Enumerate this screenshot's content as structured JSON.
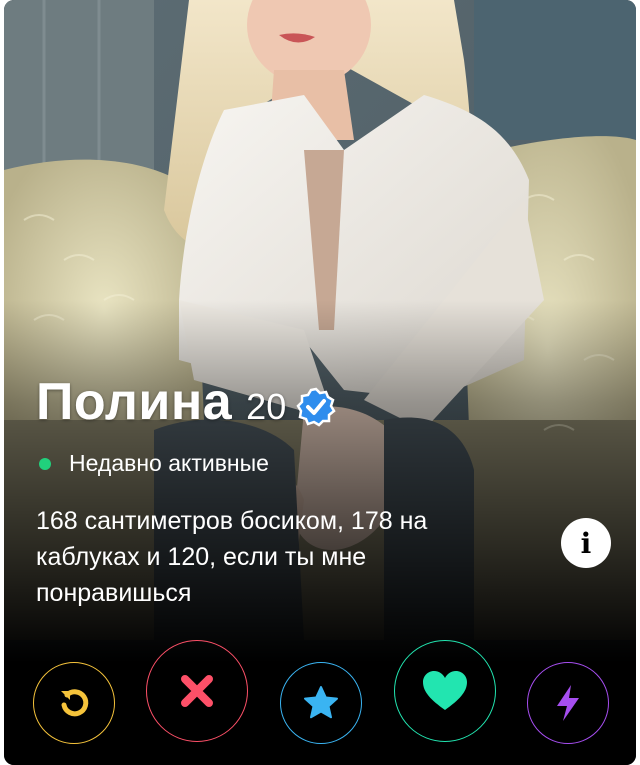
{
  "profile": {
    "name": "Полина",
    "age": "20",
    "verified_icon": "verified-check-icon",
    "status_text": "Недавно активные",
    "bio_lines": [
      "168 сантиметров босиком, 178 на",
      "каблуках и 120, если ты мне",
      "понравишься"
    ]
  },
  "info_button": {
    "icon": "info-icon",
    "label": "i"
  },
  "actions": [
    {
      "name": "rewind",
      "icon": "rewind-icon",
      "color": "#f5c33b"
    },
    {
      "name": "nope",
      "icon": "x-icon",
      "color": "#fd5068"
    },
    {
      "name": "super-like",
      "icon": "star-icon",
      "color": "#3ab4f2"
    },
    {
      "name": "like",
      "icon": "heart-icon",
      "color": "#22e5b0"
    },
    {
      "name": "boost",
      "icon": "lightning-icon",
      "color": "#a64ef0"
    }
  ],
  "colors": {
    "online_dot": "#21d07c",
    "verified_badge": "#2e8ded"
  }
}
